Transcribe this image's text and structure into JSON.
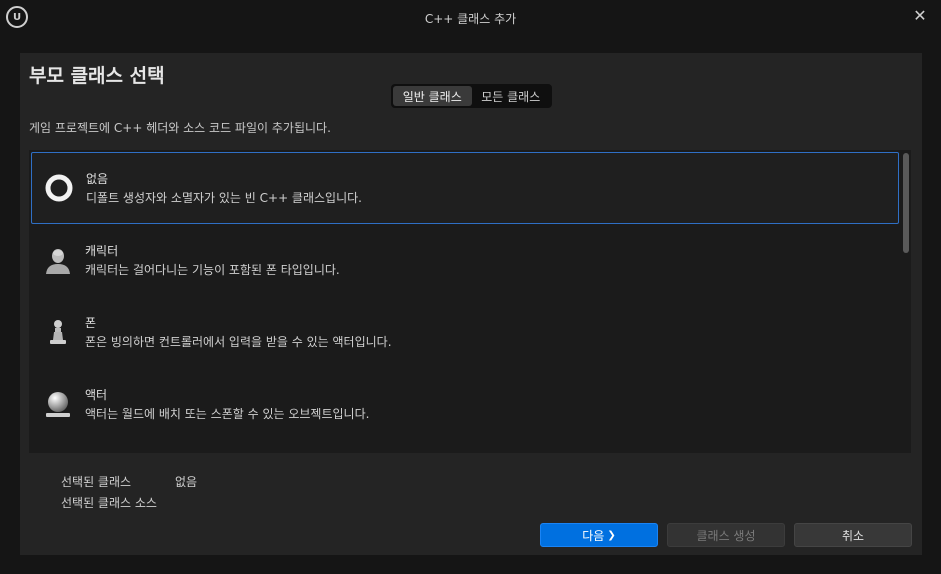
{
  "window": {
    "title": "C++ 클래스 추가",
    "close_glyph": "✕",
    "logo_glyph": "U"
  },
  "heading": "부모 클래스 선택",
  "tabs": [
    {
      "label": "일반 클래스",
      "active": true
    },
    {
      "label": "모든 클래스",
      "active": false
    }
  ],
  "description": "게임 프로젝트에 C++ 헤더와 소스 코드 파일이 추가됩니다.",
  "classes": [
    {
      "name": "없음",
      "desc": "디폴트 생성자와 소멸자가 있는 빈 C++ 클래스입니다.",
      "icon": "ring-icon",
      "selected": true
    },
    {
      "name": "캐릭터",
      "desc": "캐릭터는 걸어다니는 기능이 포함된 폰 타입입니다.",
      "icon": "character-icon",
      "selected": false
    },
    {
      "name": "폰",
      "desc": "폰은 빙의하면 컨트롤러에서 입력을 받을 수 있는 액터입니다.",
      "icon": "pawn-icon",
      "selected": false
    },
    {
      "name": "액터",
      "desc": "액터는 월드에 배치 또는 스폰할 수 있는 오브젝트입니다.",
      "icon": "actor-icon",
      "selected": false
    }
  ],
  "info": {
    "selected_class_label": "선택된 클래스",
    "selected_class_value": "없음",
    "selected_source_label": "선택된 클래스 소스",
    "selected_source_value": ""
  },
  "buttons": {
    "next": "다음",
    "next_glyph": "❯",
    "create": "클래스 생성",
    "cancel": "취소"
  },
  "colors": {
    "accent": "#0070e0",
    "selection_border": "#2f6fc5"
  }
}
